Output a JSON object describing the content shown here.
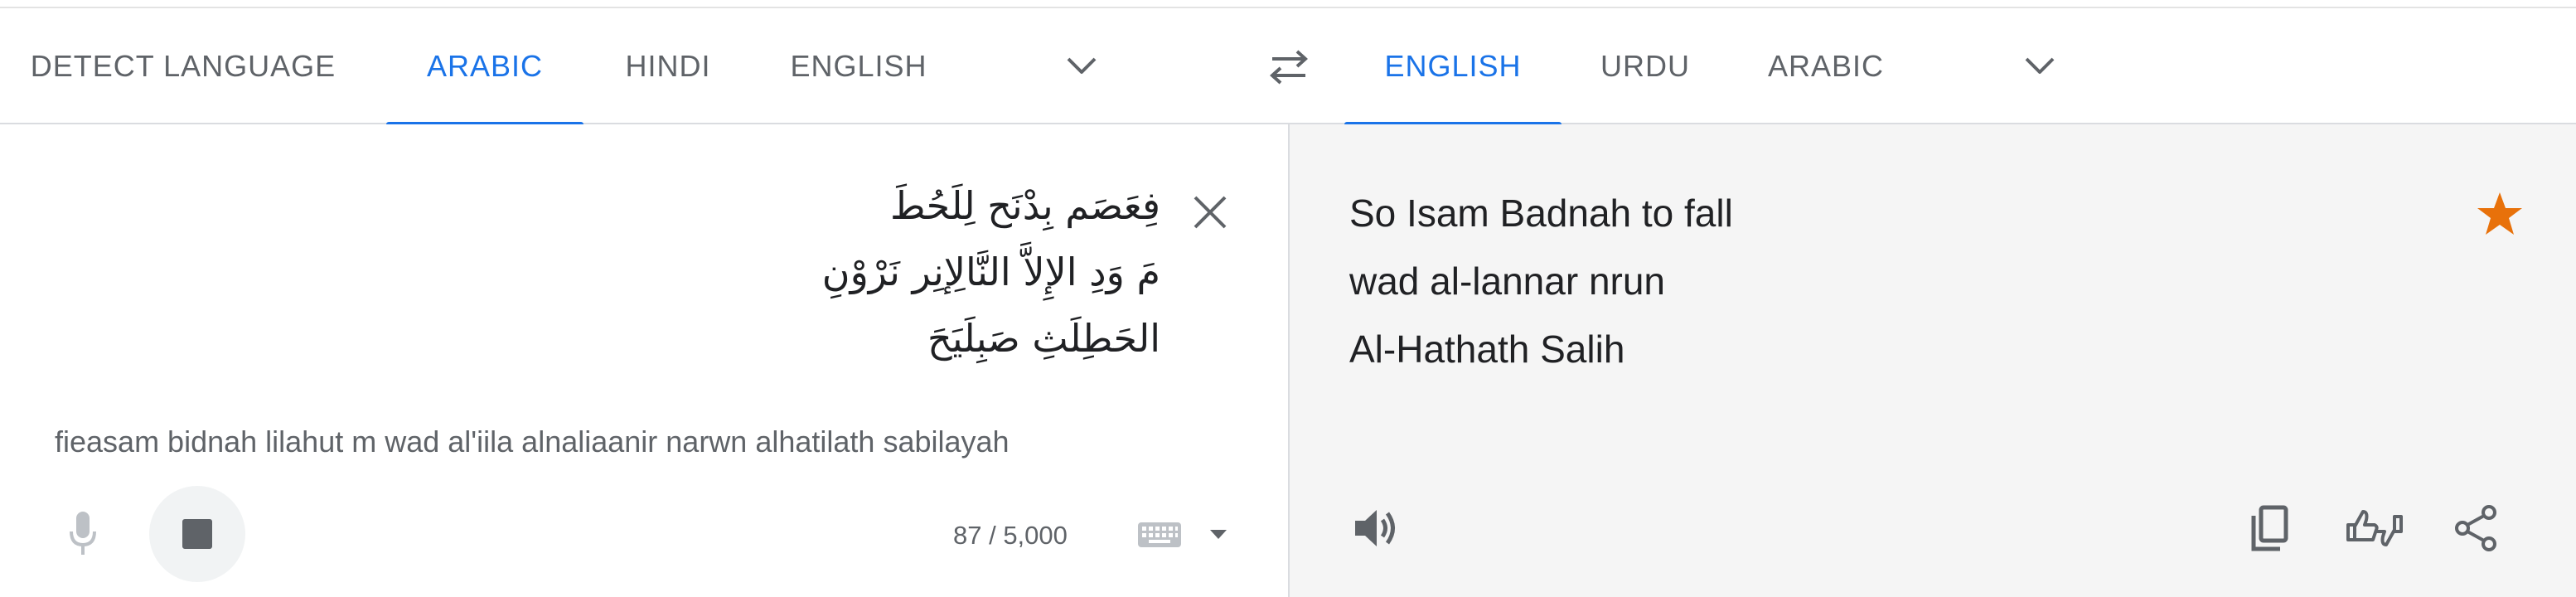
{
  "source_tabs": [
    {
      "label": "DETECT LANGUAGE",
      "active": false
    },
    {
      "label": "ARABIC",
      "active": true
    },
    {
      "label": "HINDI",
      "active": false
    },
    {
      "label": "ENGLISH",
      "active": false
    }
  ],
  "target_tabs": [
    {
      "label": "ENGLISH",
      "active": true
    },
    {
      "label": "URDU",
      "active": false
    },
    {
      "label": "ARABIC",
      "active": false
    }
  ],
  "source": {
    "lines": [
      "فِعَصَم بِدْنَح لِلَحُطَ",
      "مَ وَدِ الإِلاَّ النَّالِإنِر نَرْوْنِ",
      "الحَطِلَثِ صَبِلَيَحَ"
    ],
    "transliteration": "fieasam bidnah lilahut m wad al'iila alnaliaanir narwn alhatilath sabilayah",
    "char_count": "87 / 5,000"
  },
  "target": {
    "lines": [
      "So Isam Badnah to fall",
      "wad al-lannar nrun",
      "Al-Hathath Salih"
    ],
    "saved": true
  },
  "colors": {
    "accent": "#1a73e8",
    "star": "#e8710a",
    "icon": "#5f6368"
  },
  "icons": [
    "chevron-down-icon",
    "swap-icon",
    "close-icon",
    "mic-icon",
    "stop-icon",
    "keyboard-icon",
    "speaker-icon",
    "copy-icon",
    "feedback-icon",
    "share-icon",
    "star-icon"
  ]
}
